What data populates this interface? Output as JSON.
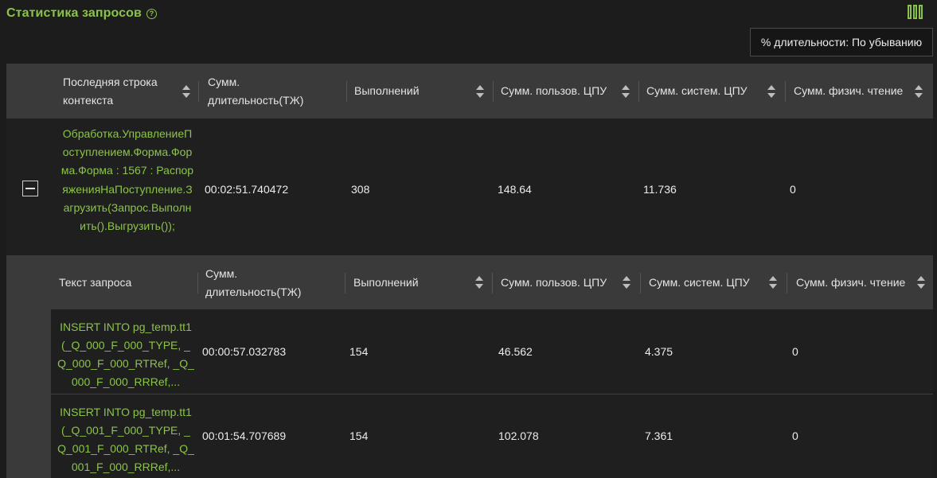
{
  "header": {
    "title": "Статистика запросов",
    "help_icon": "?",
    "columns_icon": "columns-icon"
  },
  "sort_select": {
    "value": "% длительности: По убыванию"
  },
  "main_table": {
    "columns": [
      "Последняя строка контекста",
      "Сумм. длительность(ТЖ)",
      "Выполнений",
      "Сумм. пользов. ЦПУ",
      "Сумм. систем. ЦПУ",
      "Сумм. физич. чтение"
    ],
    "row": {
      "context": "Обработка.УправлениеПоступлением.Форма.Форма.Форма : 1567 : РаспоряженияНаПоступление.Загрузить(Запрос.Выполнить().Выгрузить());",
      "duration": "00:02:51.740472",
      "executions": "308",
      "user_cpu": "148.64",
      "sys_cpu": "11.736",
      "phys_read": "0"
    }
  },
  "sub_table": {
    "columns": [
      "Текст запроса",
      "Сумм. длительность(ТЖ)",
      "Выполнений",
      "Сумм. пользов. ЦПУ",
      "Сумм. систем. ЦПУ",
      "Сумм. физич. чтение"
    ],
    "rows": [
      {
        "query": "INSERT INTO pg_temp.tt1(_Q_000_F_000_TYPE, _Q_000_F_000_RTRef, _Q_000_F_000_RRRef,...",
        "duration": "00:00:57.032783",
        "executions": "154",
        "user_cpu": "46.562",
        "sys_cpu": "4.375",
        "phys_read": "0"
      },
      {
        "query": "INSERT INTO pg_temp.tt1(_Q_001_F_000_TYPE, _Q_001_F_000_RTRef, _Q_001_F_000_RRRef,...",
        "duration": "00:01:54.707689",
        "executions": "154",
        "user_cpu": "102.078",
        "sys_cpu": "7.361",
        "phys_read": "0"
      }
    ]
  },
  "colors": {
    "accent": "#8bc34a",
    "header_bg": "#3a3a3a",
    "row_bg": "#1f1f1f",
    "page_bg": "#1c1c1c"
  }
}
